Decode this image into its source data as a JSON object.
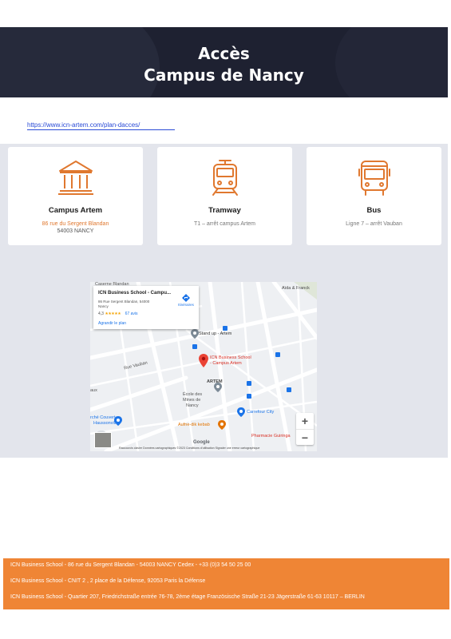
{
  "hero": {
    "line1": "Accès",
    "line2": "Campus de Nancy"
  },
  "link": {
    "text": "https://www.icn-artem.com/plan-dacces/"
  },
  "cards": [
    {
      "icon": "building-icon",
      "title": "Campus Artem",
      "line1": "86 rue du Sergent Blandan",
      "line2": "54003 NANCY"
    },
    {
      "icon": "tram-icon",
      "title": "Tramway",
      "line1": "T1 – arrêt campus Artem"
    },
    {
      "icon": "bus-icon",
      "title": "Bus",
      "line1": "Ligne 7 – arrêt Vauban"
    }
  ],
  "map": {
    "place_name": "ICN Business School - Campu...",
    "address1": "86 Rue Sergent Blandan, 54000",
    "address2": "Nancy",
    "rating": "4,3",
    "stars": "★★★★★",
    "reviews": "67 avis",
    "bigger_map": "Agrandir le plan",
    "directions": "Itinéraires",
    "pin_label1": "ICN Business School",
    "pin_label2": "- Campus Artem",
    "labels": {
      "caserne": "Caserne Blandan",
      "aida": "Aïda & Franck",
      "standup": "Stand up - Artem",
      "artem": "ARTEM",
      "ecole1": "École des",
      "ecole2": "Mines de",
      "ecole3": "Nancy",
      "carrefour": "Carrefour City",
      "marche1": "rché Couvert",
      "marche2": "Haussonville",
      "aufne": "Aufne-dik kebab",
      "pharmacie": "Pharmacie Guiringa",
      "rue_vauban": "Rue Vauban",
      "aux": "aux",
      "google": "Google",
      "attribution": "Raccourcis clavier   Données cartographiques ©2023   Conditions d'utilisation   Signaler une erreur cartographique"
    },
    "zoom_in": "+",
    "zoom_out": "−"
  },
  "footer": [
    "ICN Business School - 86 rue du Sergent Blandan - 54003 NANCY Cedex - +33 (0)3 54 50 25 00",
    "ICN Business School - CNIT 2 , 2 place de la Défense, 92053 Paris la Défense",
    "ICN Business School - Quartier 207, Friedrichstraße entrée 76-78, 2ème étage Französische Straße 21-23 Jägerstraße 61-63 10117 – BERLIN"
  ],
  "colors": {
    "accent": "#ef8535",
    "hero_bg": "#1e2131",
    "band_bg": "#e3e5ec",
    "link": "#2a4bd6"
  }
}
